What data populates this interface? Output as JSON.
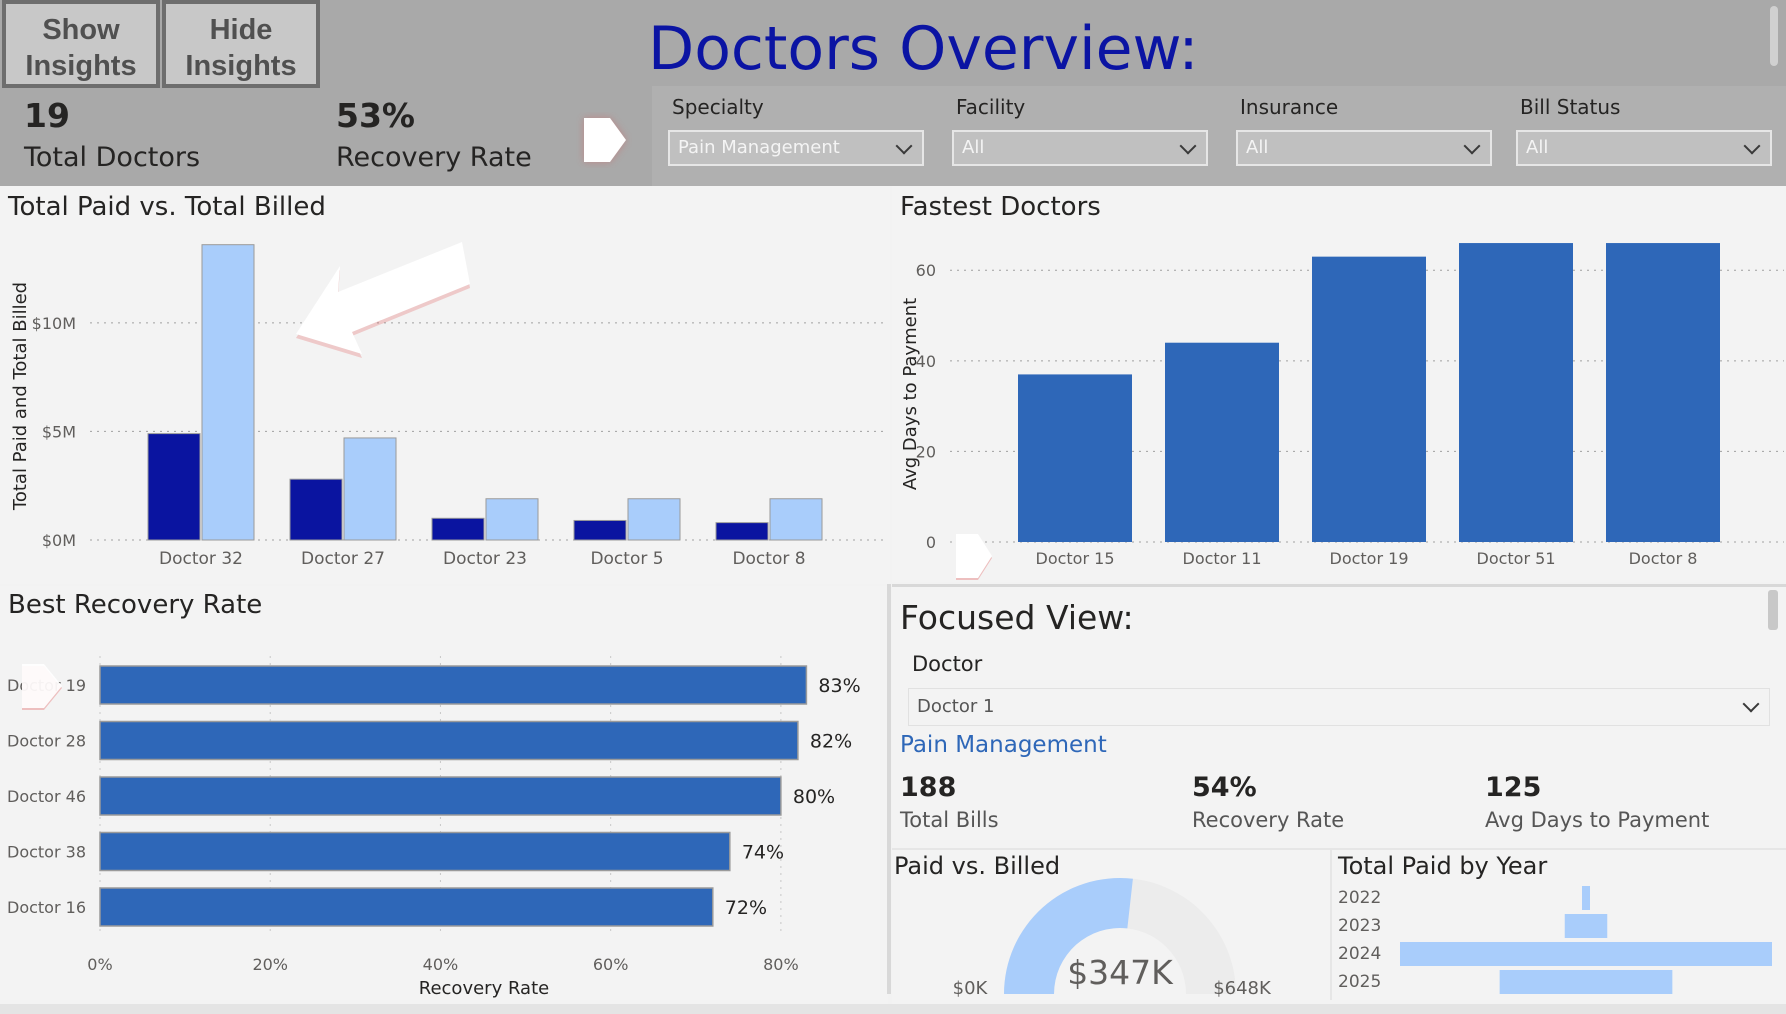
{
  "header": {
    "show_insights": "Show Insights",
    "hide_insights": "Hide Insights",
    "title": "Doctors Overview:"
  },
  "kpis": {
    "total_doctors_value": "19",
    "total_doctors_label": "Total Doctors",
    "recovery_rate_value": "53%",
    "recovery_rate_label": "Recovery Rate"
  },
  "filters": [
    {
      "label": "Specialty",
      "value": "Pain Management"
    },
    {
      "label": "Facility",
      "value": "All"
    },
    {
      "label": "Insurance",
      "value": "All"
    },
    {
      "label": "Bill Status",
      "value": "All"
    }
  ],
  "colors": {
    "paid": "#0a14a0",
    "billed": "#a9cdfb",
    "bar": "#2e67b8",
    "title_blue": "#0b14a3",
    "accent_text": "#2e67b8"
  },
  "chart_data": [
    {
      "type": "bar",
      "title": "Total Paid vs. Total Billed",
      "ylabel": "Total Paid and Total Billed",
      "categories": [
        "Doctor 32",
        "Doctor 27",
        "Doctor 23",
        "Doctor 5",
        "Doctor 8"
      ],
      "series": [
        {
          "values": [
            4.9,
            2.8,
            1.0,
            0.9,
            0.8
          ]
        },
        {
          "values": [
            13.6,
            4.7,
            1.9,
            1.9,
            1.9
          ]
        }
      ],
      "yticks": [
        "$0M",
        "$5M",
        "$10M"
      ],
      "ylim": [
        0,
        14
      ],
      "grid": true
    },
    {
      "type": "bar",
      "title": "Fastest Doctors",
      "ylabel": "Avg Days to Payment",
      "categories": [
        "Doctor 15",
        "Doctor 11",
        "Doctor 19",
        "Doctor 51",
        "Doctor 8"
      ],
      "values": [
        37,
        44,
        63,
        66,
        66
      ],
      "yticks": [
        "0",
        "20",
        "40",
        "60"
      ],
      "ylim": [
        0,
        68
      ],
      "grid": true
    },
    {
      "type": "bar",
      "orientation": "horizontal",
      "title": "Best Recovery Rate",
      "xlabel": "Recovery Rate",
      "categories": [
        "Doctor 19",
        "Doctor 28",
        "Doctor 46",
        "Doctor 38",
        "Doctor 16"
      ],
      "values": [
        83,
        82,
        80,
        74,
        72
      ],
      "labels": [
        "83%",
        "82%",
        "80%",
        "74%",
        "72%"
      ],
      "xticks": [
        "0%",
        "20%",
        "40%",
        "60%",
        "80%"
      ],
      "xlim": [
        0,
        90
      ],
      "grid": true
    },
    {
      "type": "gauge",
      "title": "Paid vs. Billed",
      "value": 347,
      "max": 648,
      "value_label": "$347K",
      "min_label": "$0K",
      "max_label": "$648K"
    },
    {
      "type": "bar",
      "orientation": "horizontal",
      "title": "Total Paid by Year",
      "categories": [
        "2022",
        "2023",
        "2024",
        "2025"
      ],
      "values": [
        0.06,
        0.32,
        2.8,
        1.3
      ]
    }
  ],
  "focus": {
    "title": "Focused View:",
    "doctor_label": "Doctor",
    "doctor_value": "Doctor 1",
    "specialty": "Pain Management",
    "stats": [
      {
        "value": "188",
        "label": "Total Bills"
      },
      {
        "value": "54%",
        "label": "Recovery Rate"
      },
      {
        "value": "125",
        "label": "Avg Days to Payment"
      }
    ]
  }
}
